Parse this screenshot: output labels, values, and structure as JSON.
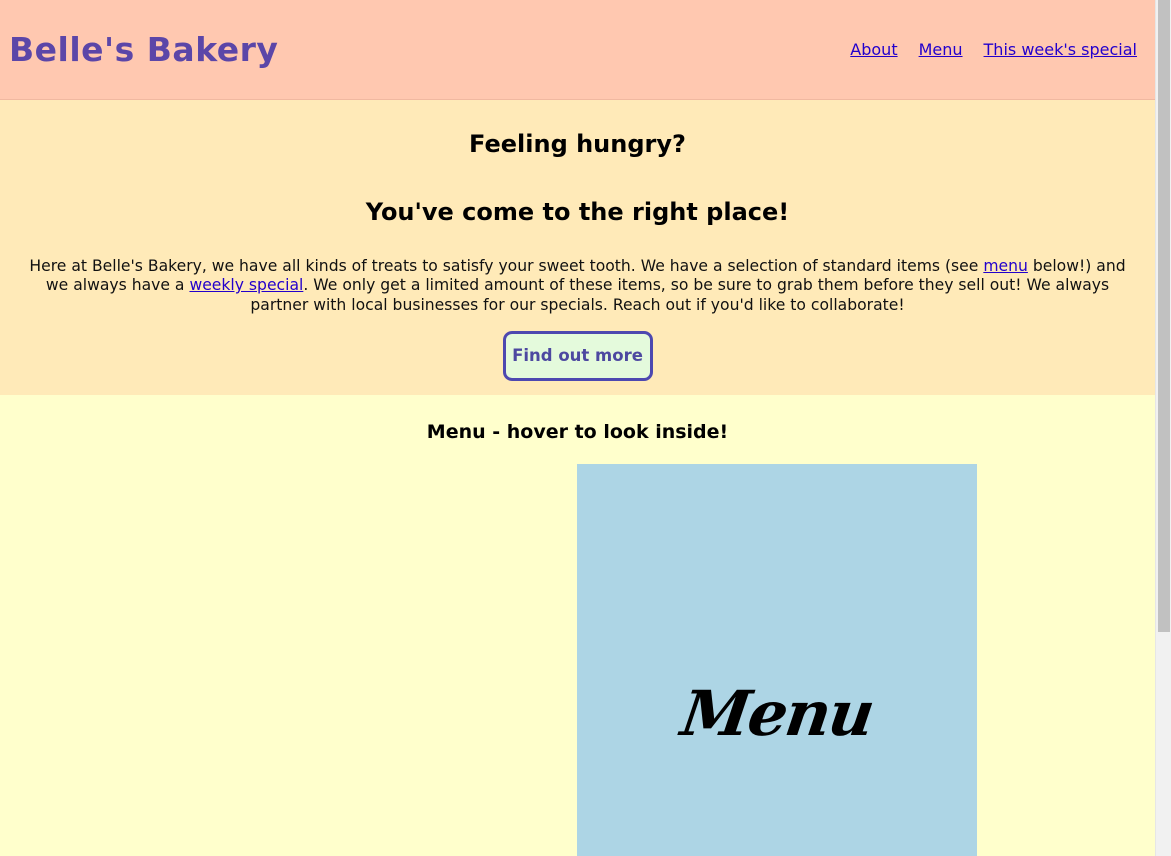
{
  "header": {
    "title": "Belle's Bakery",
    "nav": [
      "About",
      "Menu",
      "This week's special"
    ]
  },
  "hero": {
    "heading1": "Feeling hungry?",
    "heading2": "You've come to the right place!",
    "paragraph": {
      "part1": "Here at Belle's Bakery, we have all kinds of treats to satisfy your sweet tooth. We have a selection of standard items (see ",
      "link1": "menu",
      "part2": " below!) and we always have a ",
      "link2": "weekly special",
      "part3": ". We only get a limited amount of these items, so be sure to grab them before they sell out! We always partner with local businesses for our specials. Reach out if you'd like to collaborate!"
    },
    "button": "Find out more"
  },
  "menu": {
    "heading": "Menu - hover to look inside!",
    "card_label": "Menu"
  },
  "colors": {
    "header_bg": "#ffc8b0",
    "hero_bg": "#ffeab8",
    "menu_bg": "#ffffcc",
    "menu_card_bg": "#add5e5",
    "title_color": "#5b46a8",
    "button_bg": "#e4fadc",
    "button_border": "#4d48b0"
  }
}
